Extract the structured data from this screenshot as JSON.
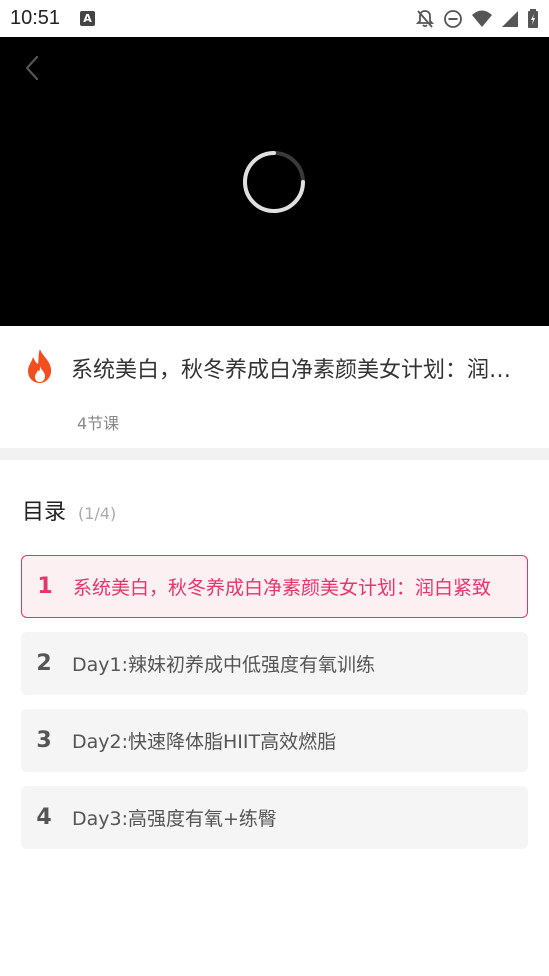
{
  "status_bar": {
    "time": "10:51",
    "app_icon_letter": "A"
  },
  "course": {
    "title": "系统美白，秋冬养成白净素颜美女计划：润白紧致",
    "lesson_count": "4节课"
  },
  "catalog": {
    "title": "目录",
    "progress": "(1/4)",
    "lessons": [
      {
        "num": "1",
        "label": "系统美白，秋冬养成白净素颜美女计划：润白紧致"
      },
      {
        "num": "2",
        "label": "Day1:辣妹初养成中低强度有氧训练"
      },
      {
        "num": "3",
        "label": "Day2:快速降体脂HIIT高效燃脂"
      },
      {
        "num": "4",
        "label": "Day3:高强度有氧+练臀"
      }
    ]
  },
  "colors": {
    "accent": "#e8336b",
    "video_bg": "#000000"
  }
}
